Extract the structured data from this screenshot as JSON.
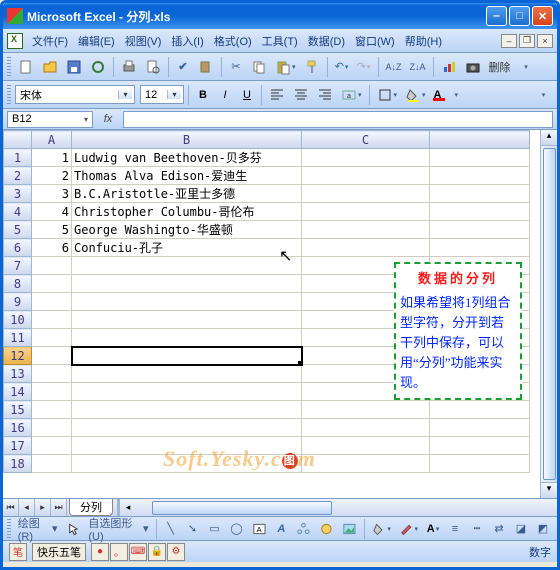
{
  "window": {
    "title": "Microsoft Excel - 分列.xls"
  },
  "menu": {
    "file": "文件(F)",
    "edit": "编辑(E)",
    "view": "视图(V)",
    "insert": "插入(I)",
    "format": "格式(O)",
    "tools": "工具(T)",
    "data": "数据(D)",
    "window": "窗口(W)",
    "help": "帮助(H)"
  },
  "format_bar": {
    "font": "宋体",
    "size": "12"
  },
  "namebox": "B12",
  "columns": [
    "A",
    "B",
    "C"
  ],
  "rows": [
    {
      "r": 1,
      "a": "1",
      "b": "Ludwig van Beethoven-贝多芬"
    },
    {
      "r": 2,
      "a": "2",
      "b": "Thomas Alva Edison-爱迪生"
    },
    {
      "r": 3,
      "a": "3",
      "b": "B.C.Aristotle-亚里士多德"
    },
    {
      "r": 4,
      "a": "4",
      "b": "Christopher Columbu-哥伦布"
    },
    {
      "r": 5,
      "a": "5",
      "b": "George Washingto-华盛顿"
    },
    {
      "r": 6,
      "a": "6",
      "b": "Confuciu-孔子"
    },
    {
      "r": 7,
      "a": "",
      "b": ""
    },
    {
      "r": 8,
      "a": "",
      "b": ""
    },
    {
      "r": 9,
      "a": "",
      "b": ""
    },
    {
      "r": 10,
      "a": "",
      "b": ""
    },
    {
      "r": 11,
      "a": "",
      "b": ""
    },
    {
      "r": 12,
      "a": "",
      "b": ""
    },
    {
      "r": 13,
      "a": "",
      "b": ""
    },
    {
      "r": 14,
      "a": "",
      "b": ""
    },
    {
      "r": 15,
      "a": "",
      "b": ""
    },
    {
      "r": 16,
      "a": "",
      "b": ""
    },
    {
      "r": 17,
      "a": "",
      "b": ""
    },
    {
      "r": 18,
      "a": "",
      "b": ""
    }
  ],
  "selected_row": 12,
  "sheet_name": "分列",
  "callout": {
    "title": "数据的分列",
    "body": "如果希望将1列组合型字符，分开到若干列中保存，可以用“分列”功能来实现。"
  },
  "watermark": "Soft.Yesky.c",
  "drawbar": {
    "draw_label": "绘图(R)",
    "autoshape": "自选图形(U)"
  },
  "status": {
    "ime": "快乐五笔",
    "mode": "数字"
  }
}
